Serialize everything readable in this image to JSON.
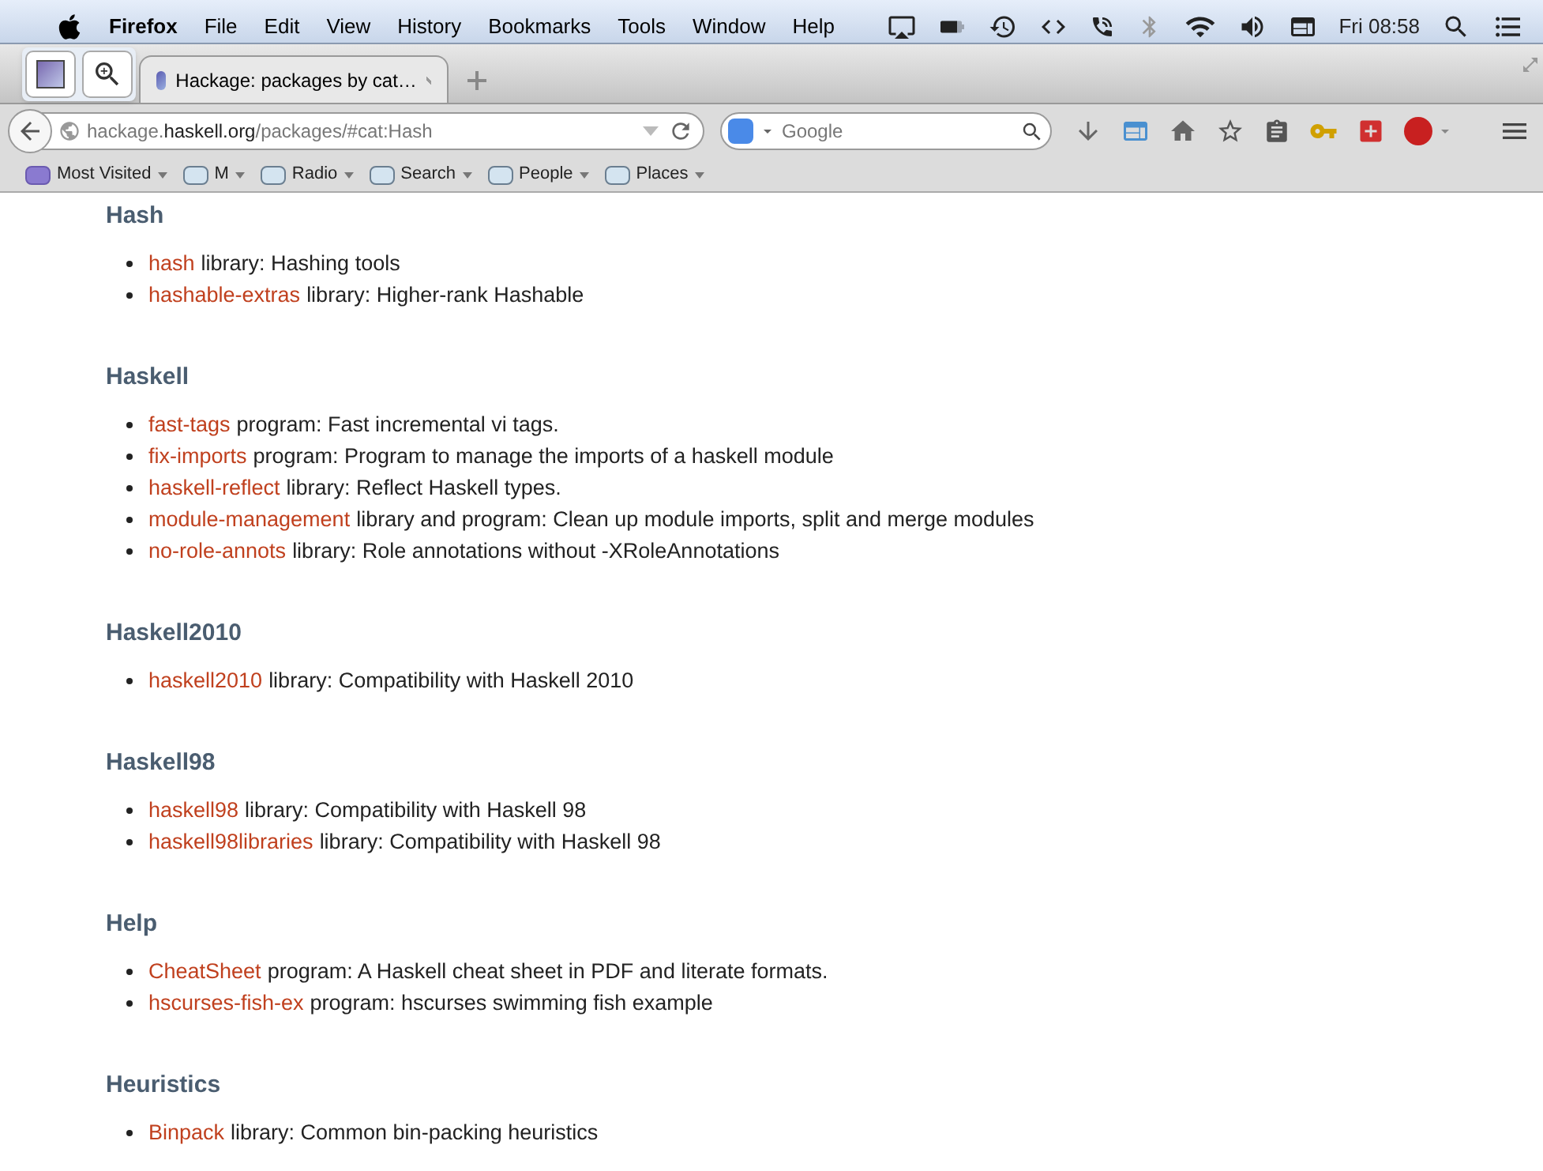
{
  "menu_bar": {
    "app": "Firefox",
    "items": [
      "File",
      "Edit",
      "View",
      "History",
      "Bookmarks",
      "Tools",
      "Window",
      "Help"
    ],
    "clock": "Fri 08:58"
  },
  "tabs": [
    {
      "title": "Hackage: packages by cat…",
      "selected": true
    }
  ],
  "address_bar": {
    "url": "hackage.**haskell.org**/packages/#cat:Hash"
  },
  "search": {
    "placeholder": "Google"
  },
  "bookmarks": [
    {
      "label": "Most Visited",
      "kind": "smart"
    },
    {
      "label": "M",
      "kind": "folder"
    },
    {
      "label": "Radio",
      "kind": "folder"
    },
    {
      "label": "Search",
      "kind": "folder"
    },
    {
      "label": "People",
      "kind": "folder"
    },
    {
      "label": "Places",
      "kind": "folder"
    }
  ],
  "categories": [
    {
      "title": "Hash",
      "packages": [
        {
          "name": "hash",
          "text": "library: Hashing tools"
        },
        {
          "name": "hashable-extras",
          "text": "library: Higher-rank Hashable"
        }
      ]
    },
    {
      "title": "Haskell",
      "packages": [
        {
          "name": "fast-tags",
          "text": "program: Fast incremental vi tags."
        },
        {
          "name": "fix-imports",
          "text": "program: Program to manage the imports of a haskell module"
        },
        {
          "name": "haskell-reflect",
          "text": "library: Reflect Haskell types."
        },
        {
          "name": "module-management",
          "text": "library and program: Clean up module imports, split and merge modules"
        },
        {
          "name": "no-role-annots",
          "text": "library: Role annotations without -XRoleAnnotations"
        }
      ]
    },
    {
      "title": "Haskell2010",
      "packages": [
        {
          "name": "haskell2010",
          "text": "library: Compatibility with Haskell 2010"
        }
      ]
    },
    {
      "title": "Haskell98",
      "packages": [
        {
          "name": "haskell98",
          "text": "library: Compatibility with Haskell 98"
        },
        {
          "name": "haskell98libraries",
          "text": "library: Compatibility with Haskell 98"
        }
      ]
    },
    {
      "title": "Help",
      "packages": [
        {
          "name": "CheatSheet",
          "text": "program: A Haskell cheat sheet in PDF and literate formats."
        },
        {
          "name": "hscurses-fish-ex",
          "text": "program: hscurses swimming fish example"
        }
      ]
    },
    {
      "title": "Heuristics",
      "packages": [
        {
          "name": "Binpack",
          "text": "library: Common bin-packing heuristics"
        }
      ]
    }
  ]
}
